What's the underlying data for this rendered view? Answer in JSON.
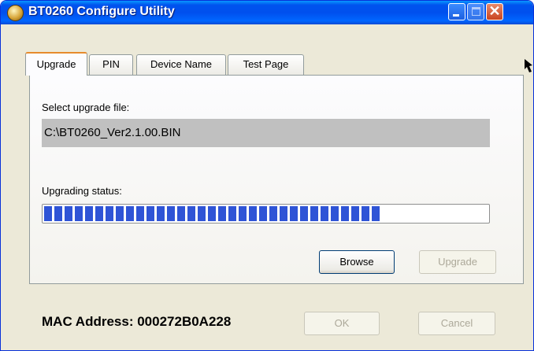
{
  "window": {
    "title": "BT0260 Configure Utility",
    "icon": "app-badge-icon"
  },
  "titlebar_buttons": {
    "minimize": "_",
    "maximize": "□",
    "close": "✕"
  },
  "tabs": [
    {
      "label": "Upgrade",
      "active": true
    },
    {
      "label": "PIN",
      "active": false
    },
    {
      "label": "Device Name",
      "active": false
    },
    {
      "label": "Test Page",
      "active": false
    }
  ],
  "upgrade": {
    "select_label": "Select upgrade file:",
    "file_path": "C:\\BT0260_Ver2.1.00.BIN",
    "status_label": "Upgrading status:",
    "progress_fraction": 0.77,
    "browse_label": "Browse",
    "upgrade_label": "Upgrade"
  },
  "footer": {
    "mac_address_text": "MAC Address: 000272B0A228",
    "ok_label": "OK",
    "cancel_label": "Cancel"
  },
  "colors": {
    "title_bar": "#0054e3",
    "progress_block": "#2f54d6",
    "field_background": "#c0c0c0",
    "dialog_face": "#ece9d8"
  }
}
